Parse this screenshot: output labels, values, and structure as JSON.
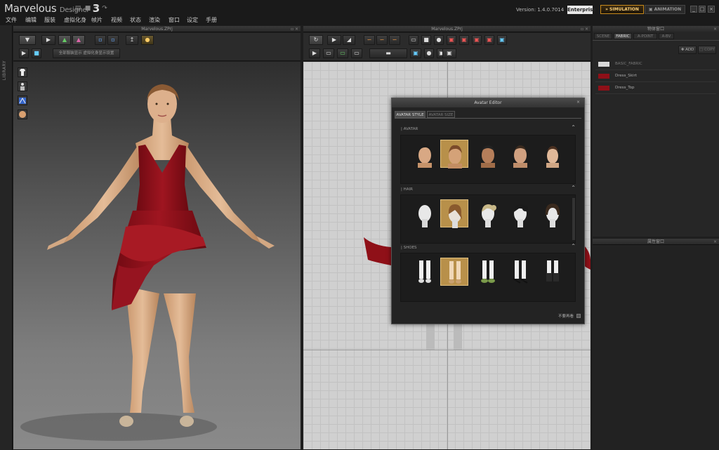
{
  "app": {
    "name": "Marvelous",
    "name_suffix": "Designer",
    "name_number": "3",
    "version": "Version:  1.4.0.7014",
    "edition": "Enterprise",
    "mode_simulation": "SIMULATION",
    "mode_animation": "ANIMATION"
  },
  "menu": [
    "文件",
    "编辑",
    "服装",
    "虚拟化身",
    "帧片",
    "视频",
    "状态",
    "渲染",
    "窗口",
    "设定",
    "手册"
  ],
  "library_label": "LIBRARY",
  "panels": {
    "view3d_title": "Marvelous.ZPrj",
    "view2d_title": "Marvelous.ZPrj",
    "object_browser_title": "物体窗口",
    "property_editor_title": "属性窗口"
  },
  "toolbar3d": {
    "field_text": "全部服装显示  虚拟化身显示设置"
  },
  "object_browser": {
    "tabs": [
      "SCENE",
      "FABRIC",
      "A-POINT",
      "A-BV"
    ],
    "active_tab": "FABRIC",
    "add_label": "ADD",
    "copy_label": "COPY",
    "fabrics": [
      {
        "name": "BASIC_FABRIC",
        "color": "#d8d8d8"
      },
      {
        "name": "Dress_Skirt",
        "color": "#8f1018"
      },
      {
        "name": "Dress_Top",
        "color": "#8f1018"
      }
    ]
  },
  "avatar_editor": {
    "title": "Avatar Editor",
    "tabs": [
      "AVATAR STYLE",
      "AVATAR SIZE"
    ],
    "active_tab": "AVATAR STYLE",
    "sections": [
      {
        "label": "AVATAR",
        "count": 5,
        "selected": 1
      },
      {
        "label": "HAIR",
        "count": 5,
        "selected": 1
      },
      {
        "label": "SHOES",
        "count": 5,
        "selected": 1
      }
    ],
    "footer_label": "不要再看"
  },
  "colors": {
    "accent": "#c88a1c",
    "dress": "#8f1018",
    "skin": "#d9ad85"
  }
}
